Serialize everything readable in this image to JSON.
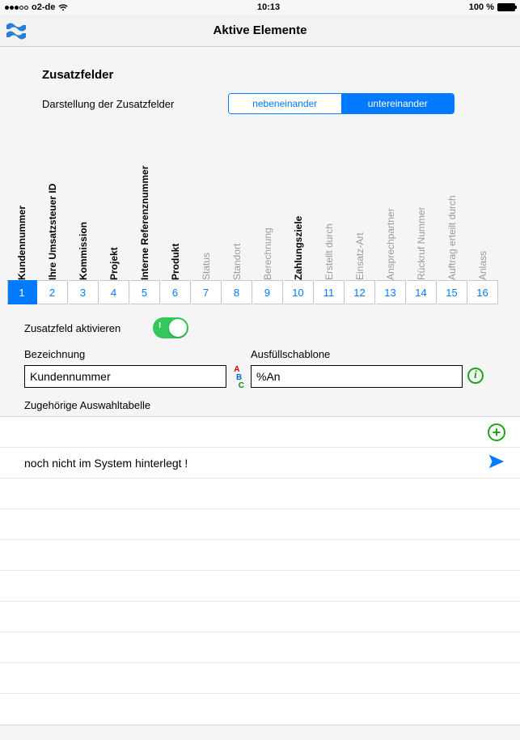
{
  "statusbar": {
    "carrier": "o2-de",
    "time": "10:13",
    "battery": "100 %"
  },
  "nav": {
    "title": "Aktive Elemente"
  },
  "sectionTitle": "Zusatzfelder",
  "displayLabel": "Darstellung der Zusatzfelder",
  "segments": {
    "a": "nebeneinander",
    "b": "untereinander",
    "selected": "b"
  },
  "fields": [
    {
      "num": "1",
      "label": "Kundennummer",
      "active": true,
      "selected": true
    },
    {
      "num": "2",
      "label": "Ihre Umsatzsteuer ID",
      "active": true,
      "selected": false
    },
    {
      "num": "3",
      "label": "Kommission",
      "active": true,
      "selected": false
    },
    {
      "num": "4",
      "label": "Projekt",
      "active": true,
      "selected": false
    },
    {
      "num": "5",
      "label": "Interne Referenznummer",
      "active": true,
      "selected": false
    },
    {
      "num": "6",
      "label": "Produkt",
      "active": true,
      "selected": false
    },
    {
      "num": "7",
      "label": "Status",
      "active": false,
      "selected": false
    },
    {
      "num": "8",
      "label": "Standort",
      "active": false,
      "selected": false
    },
    {
      "num": "9",
      "label": "Berechnung",
      "active": false,
      "selected": false
    },
    {
      "num": "10",
      "label": "Zahlungsziele",
      "active": true,
      "selected": false
    },
    {
      "num": "11",
      "label": "Erstellt durch",
      "active": false,
      "selected": false
    },
    {
      "num": "12",
      "label": "Einsatz-Art",
      "active": false,
      "selected": false
    },
    {
      "num": "13",
      "label": "Ansprechpartner",
      "active": false,
      "selected": false
    },
    {
      "num": "14",
      "label": "Rückruf Nummer",
      "active": false,
      "selected": false
    },
    {
      "num": "15",
      "label": "Auftrag erteilt durch",
      "active": false,
      "selected": false
    },
    {
      "num": "16",
      "label": "Anlass",
      "active": false,
      "selected": false
    }
  ],
  "activateLabel": "Zusatzfeld aktivieren",
  "activateOn": true,
  "designation": {
    "label": "Bezeichnung",
    "value": "Kundennummer"
  },
  "template": {
    "label": "Ausfüllschablone",
    "value": "%An"
  },
  "selectionTitle": "Zugehörige Auswahltabelle",
  "selectionMessage": "noch nicht im System hinterlegt !"
}
